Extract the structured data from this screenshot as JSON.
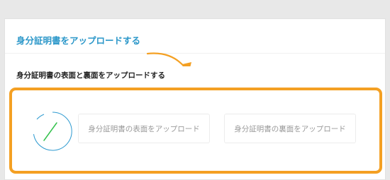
{
  "card": {
    "title": "身分証明書をアップロードする"
  },
  "section": {
    "label": "身分証明書の表面と裏面をアップロードする"
  },
  "uploads": {
    "front_label": "身分証明書の表面をアップロード",
    "back_label": "身分証明書の裏面をアップロード"
  },
  "icons": {
    "spinner": "loading-spinner-icon",
    "arrow": "curved-arrow-icon"
  },
  "colors": {
    "title": "#2b97c9",
    "highlight": "#f4a023",
    "spinner": "#2e9ad0",
    "spinner_line": "#35c24e"
  }
}
